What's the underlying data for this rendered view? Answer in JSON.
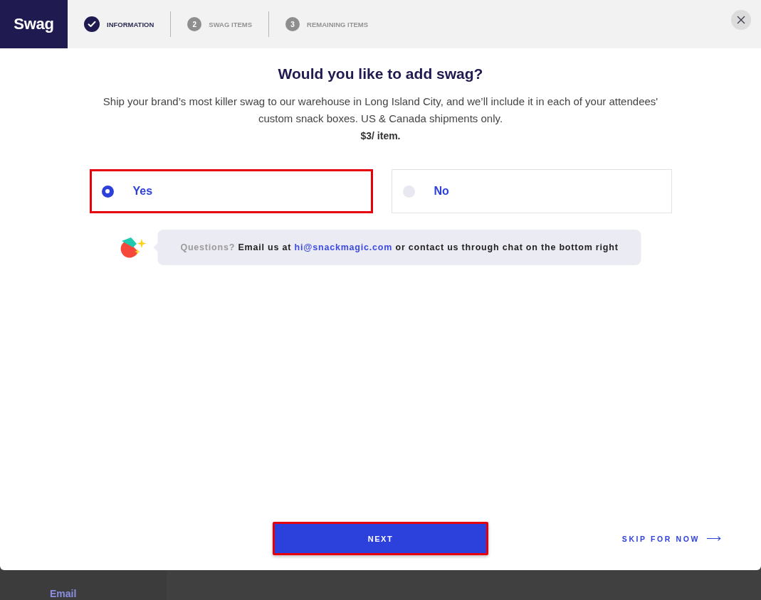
{
  "header": {
    "logo": "Swag",
    "steps": [
      {
        "label": "INFORMATION",
        "completed": true
      },
      {
        "number": "2",
        "label": "SWAG ITEMS",
        "completed": false
      },
      {
        "number": "3",
        "label": "REMAINING ITEMS",
        "completed": false
      }
    ]
  },
  "question": {
    "title": "Would you like to add swag?",
    "description": "Ship your brand’s most killer swag to our warehouse in Long Island City, and we’ll include it in each of your attendees' custom snack boxes. US & Canada shipments only.",
    "price": "$3/ item."
  },
  "options": [
    {
      "label": "Yes",
      "selected": true,
      "highlighted": true
    },
    {
      "label": "No",
      "selected": false,
      "highlighted": false
    }
  ],
  "help": {
    "lead": "Questions?",
    "text": "Email us at",
    "email": "hi@snackmagic.com",
    "tail": "or contact us through chat on the bottom right"
  },
  "footer": {
    "next": {
      "label": "NEXT",
      "highlighted": true
    },
    "skip": "SKIP FOR NOW"
  },
  "background_page": {
    "label": "Email"
  }
}
